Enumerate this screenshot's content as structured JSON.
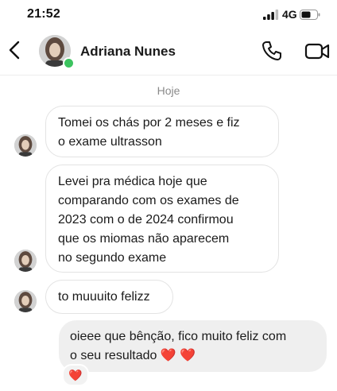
{
  "status_bar": {
    "time": "21:52",
    "network": "4G"
  },
  "header": {
    "contact_name": "Adriana Nunes"
  },
  "chat": {
    "day_label": "Hoje",
    "incoming": [
      "Tomei os chás por 2 meses e fiz\no exame ultrasson",
      "Levei pra médica hoje que\ncomparando com os exames de\n2023 com o de 2024 confirmou\nque os miomas não aparecem\nno segundo exame",
      "to muuuito felizz"
    ],
    "outgoing": "oieee que bênção, fico muito feliz com\no seu resultado ❤️ ❤️",
    "reaction": "❤️"
  },
  "colors": {
    "online": "#3cc35f",
    "outgoing_bubble": "#efefef",
    "heart": "#e0243a"
  },
  "icons": [
    "back-icon",
    "phone-icon",
    "video-camera-icon",
    "signal-icon",
    "battery-icon"
  ]
}
